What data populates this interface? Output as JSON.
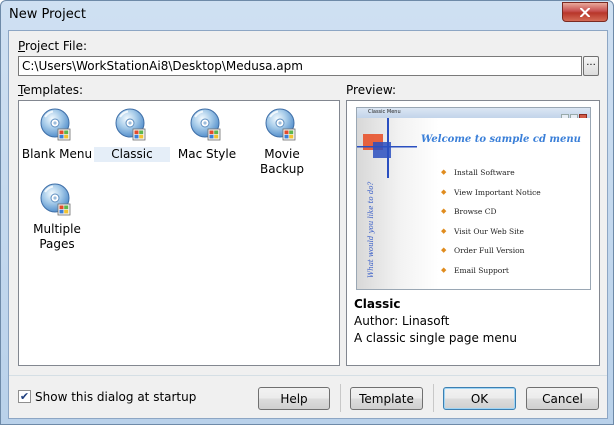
{
  "window": {
    "title": "New Project"
  },
  "project_file": {
    "label": "Project File:",
    "value": "C:\\Users\\WorkStationAi8\\Desktop\\Medusa.apm",
    "browse_label": "···"
  },
  "templates": {
    "label": "Templates:",
    "items": [
      {
        "label": "Blank Menu",
        "icon": "cd-icon",
        "selected": false
      },
      {
        "label": "Classic",
        "icon": "cd-icon",
        "selected": true
      },
      {
        "label": "Mac Style",
        "icon": "cd-icon",
        "selected": false
      },
      {
        "label": "Movie Backup",
        "icon": "cd-icon",
        "selected": false
      },
      {
        "label": "Multiple Pages",
        "icon": "cd-icon",
        "selected": false
      }
    ]
  },
  "preview": {
    "label": "Preview:",
    "thumbnail": {
      "window_title": "Classic Menu",
      "heading": "Welcome to sample cd menu",
      "side_text": "What would you like to do?",
      "items": [
        "Install Software",
        "View Important Notice",
        "Browse CD",
        "Visit Our Web Site",
        "Order Full Version",
        "Email Support"
      ]
    },
    "name": "Classic",
    "author": "Author: Linasoft",
    "description": "A classic single page menu"
  },
  "footer": {
    "show_at_startup_label": "Show this dialog at startup",
    "show_at_startup_checked": true,
    "help_label": "Help",
    "template_label": "Template",
    "ok_label": "OK",
    "cancel_label": "Cancel"
  },
  "colors": {
    "accent": "#3a7fd8",
    "close": "#c75050",
    "bullet": "#e08c1e"
  }
}
